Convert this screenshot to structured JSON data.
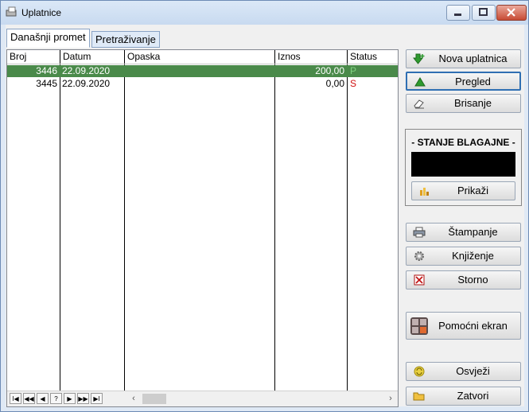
{
  "window": {
    "title": "Uplatnice"
  },
  "tabs": [
    {
      "label": "Današnji promet"
    },
    {
      "label": "Pretraživanje"
    }
  ],
  "grid": {
    "columns": [
      "Broj",
      "Datum",
      "Opaska",
      "Iznos",
      "Status"
    ],
    "rows": [
      {
        "broj": "3446",
        "datum": "22.09.2020",
        "opaska": "",
        "iznos": "200,00",
        "status": "P"
      },
      {
        "broj": "3445",
        "datum": "22.09.2020",
        "opaska": "",
        "iznos": "0,00",
        "status": "S"
      }
    ],
    "nav": [
      "I◀",
      "◀◀",
      "◀",
      "?",
      "▶",
      "▶▶",
      "▶I"
    ]
  },
  "buttons": {
    "nova": "Nova uplatnica",
    "pregled": "Pregled",
    "brisanje": "Brisanje",
    "prikazi": "Prikaži",
    "stampanje": "Štampanje",
    "knjizenje": "Knjiženje",
    "storno": "Storno",
    "pomocni": "Pomoćni ekran",
    "osvjezi": "Osvježi",
    "zatvori": "Zatvori"
  },
  "stanje": {
    "title": "- STANJE BLAGAJNE -",
    "value": ""
  },
  "colors": {
    "selected_row": "#4a8a4a",
    "status_p": "#2f9d2f",
    "status_s": "#d01010"
  }
}
